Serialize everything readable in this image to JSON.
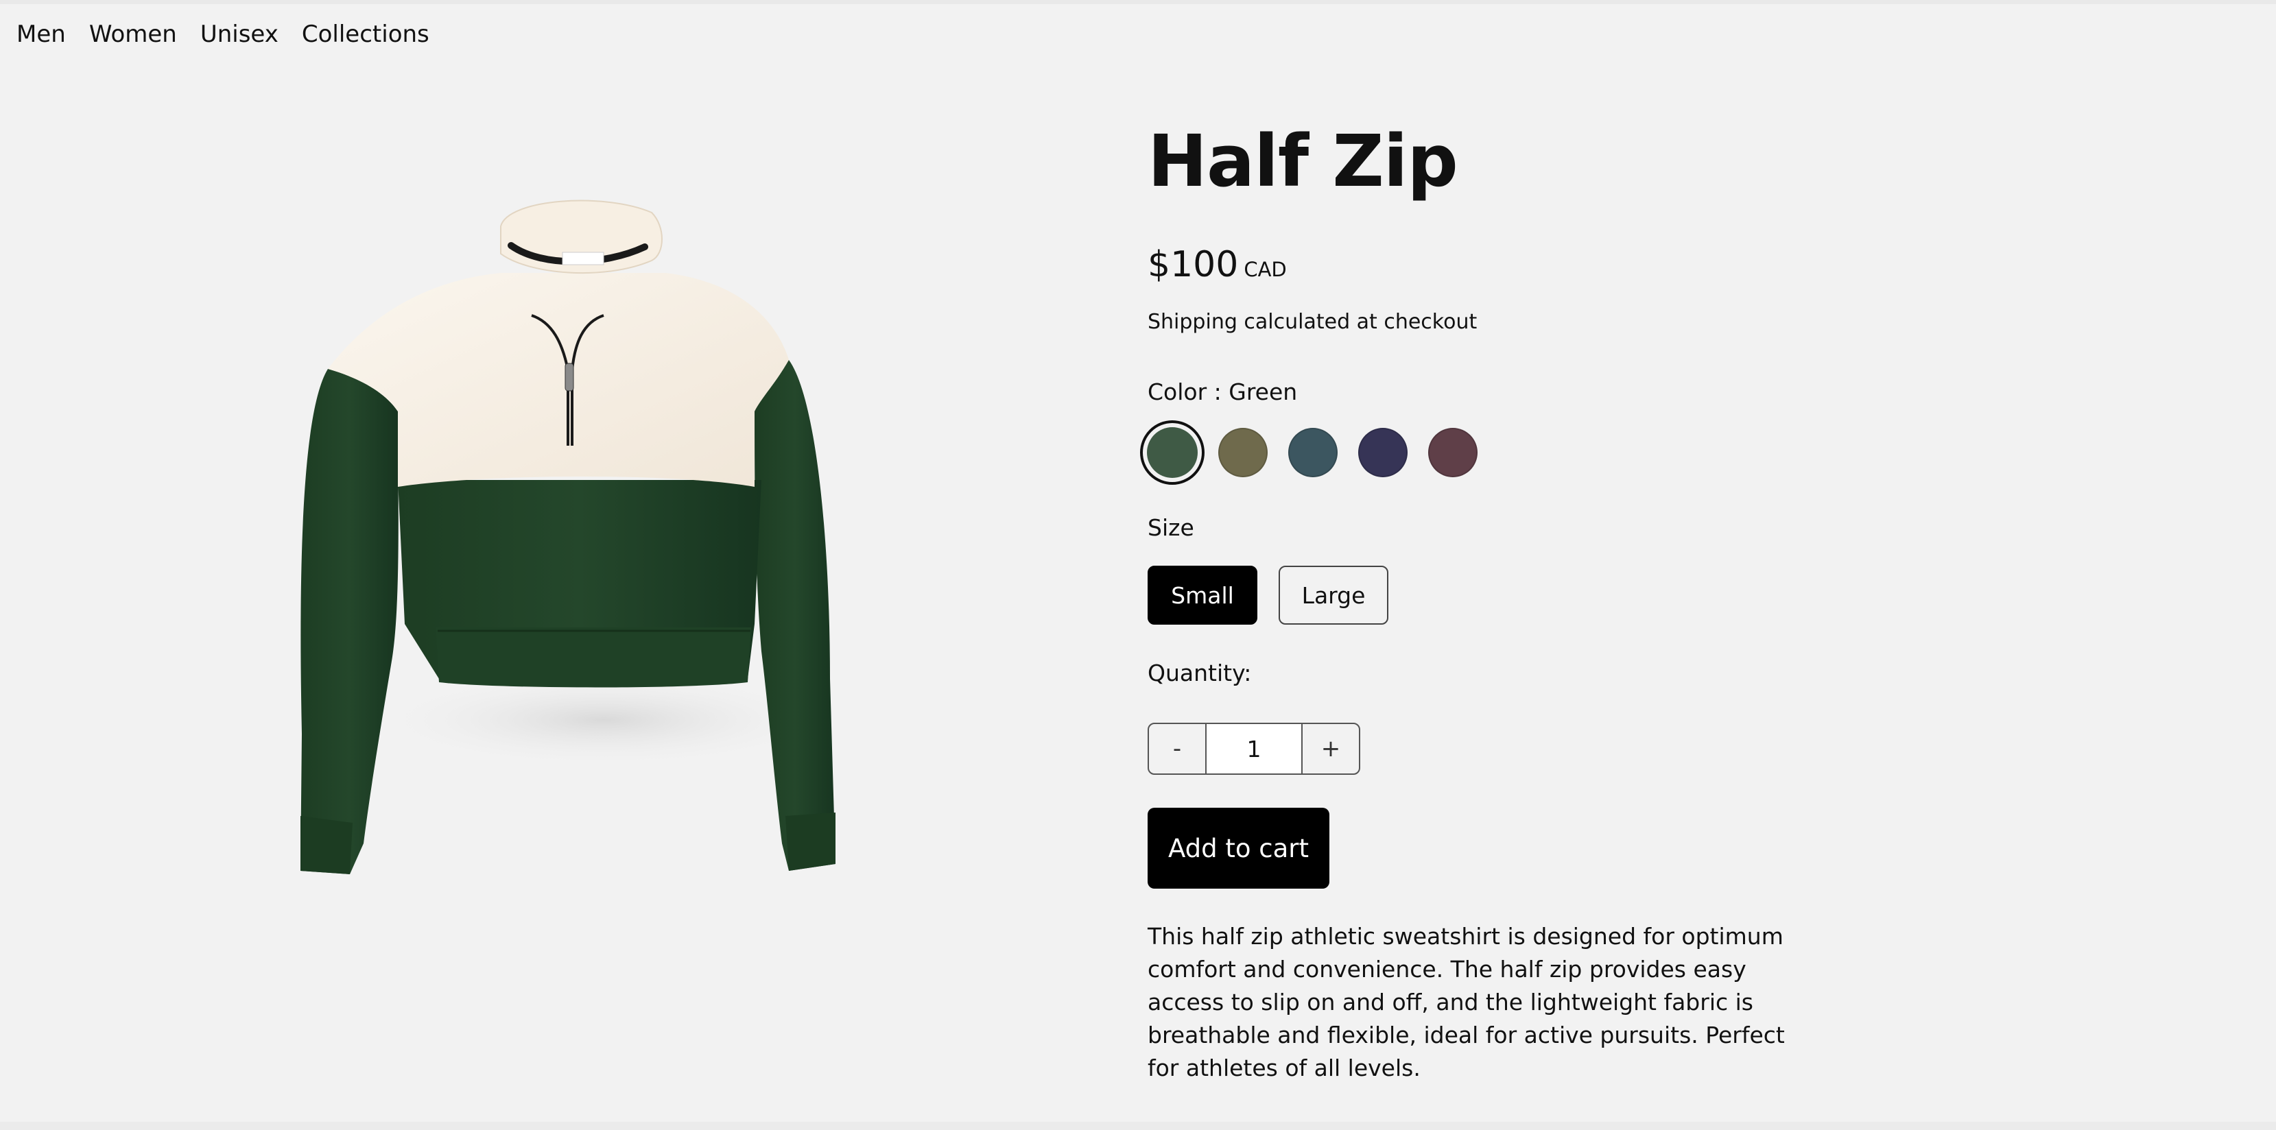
{
  "nav": {
    "items": [
      "Men",
      "Women",
      "Unisex",
      "Collections"
    ]
  },
  "product": {
    "title": "Half Zip",
    "price": "$100",
    "currency": "CAD",
    "shipping_note": "Shipping calculated at checkout",
    "color_label": "Color : Green",
    "colors": [
      {
        "name": "Green",
        "hex": "#3f5a45",
        "selected": true
      },
      {
        "name": "Olive",
        "hex": "#6f6a4c",
        "selected": false
      },
      {
        "name": "Teal",
        "hex": "#3c5660",
        "selected": false
      },
      {
        "name": "Navy",
        "hex": "#363456",
        "selected": false
      },
      {
        "name": "Plum",
        "hex": "#5f3f48",
        "selected": false
      }
    ],
    "size_label": "Size",
    "sizes": [
      {
        "label": "Small",
        "selected": true
      },
      {
        "label": "Large",
        "selected": false
      }
    ],
    "quantity_label": "Quantity:",
    "quantity": {
      "decrement": "-",
      "value": "1",
      "increment": "+"
    },
    "add_to_cart": "Add to cart",
    "description": "This half zip athletic sweatshirt is designed for optimum comfort and convenience. The half zip provides easy access to slip on and off, and the lightweight fabric is breathable and flexible, ideal for active pursuits. Perfect for athletes of all levels."
  }
}
